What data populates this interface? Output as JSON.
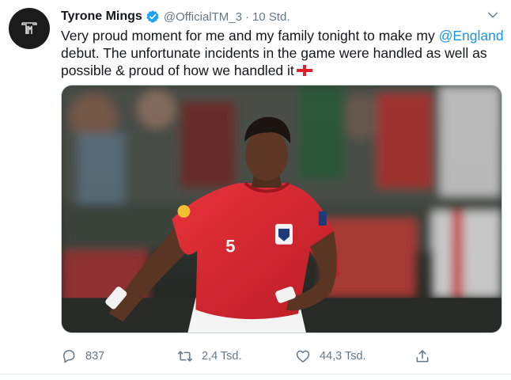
{
  "author": {
    "name": "Tyrone Mings",
    "handle": "@OfficialTM_3",
    "separator": "·",
    "time": "10 Std.",
    "verified": true,
    "avatar_icon": "tm-monogram-logo"
  },
  "tweet": {
    "text_before": "Very proud moment for me and my family tonight to make my ",
    "mention": "@England",
    "text_after": " debut. The unfortunate incidents in the game were handled as well as possible & proud of how we handled it",
    "flag_icon": "england-flag-icon",
    "media": {
      "type": "photo",
      "shirt_number": "5"
    }
  },
  "actions": {
    "reply": {
      "icon": "reply-icon",
      "count": "837"
    },
    "retweet": {
      "icon": "retweet-icon",
      "count": "2,4 Tsd."
    },
    "like": {
      "icon": "heart-icon",
      "count": "44,3 Tsd."
    },
    "share": {
      "icon": "share-icon"
    }
  },
  "colors": {
    "link": "#1b95e0",
    "muted": "#657786",
    "verified": "#1da1f2",
    "shirt": "#d9232e"
  }
}
